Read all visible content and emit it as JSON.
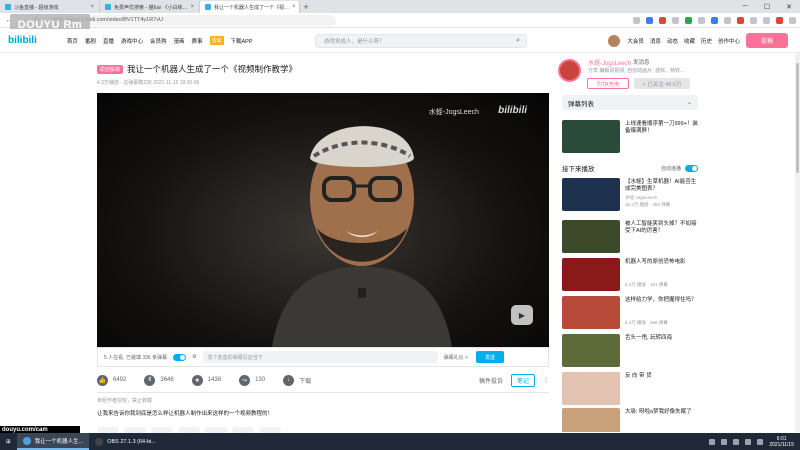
{
  "browser": {
    "tabs": [
      {
        "label": "斗鱼直播 - 超级游戏"
      },
      {
        "label": "免费声优搜索 - 猫Ear 《小白练…"
      },
      {
        "label": "我让一个机器人生成了一个《视…"
      }
    ],
    "url": "https://www.bilibili.com/video/BV1TT4y1R7vU"
  },
  "watermark": "DOUYU Rm",
  "site": {
    "logo": "bilibili",
    "nav": [
      "首页",
      "番剧",
      "直播",
      "游戏中心",
      "会员购",
      "漫画",
      "赛事"
    ],
    "nav_badge": "活动",
    "download_app": "下载APP",
    "search_placeholder": "游戏党成人，是什么呀？",
    "user_links": [
      "大会员",
      "消息",
      "动态",
      "收藏",
      "历史",
      "创作中心"
    ],
    "upload_button": "投稿"
  },
  "video": {
    "tag": "原创投稿",
    "title": "我让一个机器人生成了一个《视频制作教学》",
    "meta": "4.3万播放 · 总弹幕数236   2021-11-15 18:30:08",
    "channel_watermark": "水蛭-JogsLeech",
    "player_logo": "bilibili"
  },
  "danmu": {
    "viewers": "5 人在看, 已装填 336 条弹幕",
    "placeholder": "发个友善的弹幕见证当下",
    "etiquette": "弹幕礼仪 >",
    "send": "发送"
  },
  "actions": {
    "like": "6492",
    "coin": "3646",
    "fav": "1438",
    "share": "130",
    "download": "下载",
    "report": "稿件投诉",
    "note": "笔记"
  },
  "warning": "未经作者授权，禁止转载",
  "description": "让我来告诉你我到底是怎么样让机器人制作出来这样的一个视频教程的！",
  "uploader": {
    "name": "水蛭-JogsLeech",
    "message": "发消息",
    "desc": "分享 编解说视频, 自创动画片; 游戏、特效...",
    "charge": "为TA充电",
    "follow": "+ 已关注 46.6万"
  },
  "danmu_list": "弹幕列表",
  "next_play": "接下来播放",
  "autoplay": "自动连播",
  "recommendations": [
    {
      "title": "上线速看顺序第一刀999+！装备爆满屏！",
      "up": "",
      "stat": "",
      "color": "#2b4b3a"
    },
    {
      "title": "【水蛭】生草机器！AI能否生成完美图表？",
      "up": "水蛭-JogsLeech",
      "stat": "16.3万 播放 · 383 弹幕",
      "color": "#1e3250"
    },
    {
      "title": "被人工智能笑到头掉？不如接受下AI的厉害！",
      "up": "",
      "stat": "",
      "color": "#3d4a2a"
    },
    {
      "title": "机器人写的原创恐怖电影",
      "up": "",
      "stat": "5.4万 播放 · 181 弹幕",
      "color": "#8a1a1a"
    },
    {
      "title": "这样给力学，你把握得住吗？",
      "up": "",
      "stat": "6.4万 播放 · 460 弹幕",
      "color": "#b84a3a"
    },
    {
      "title": "舌头一甩, 玩转四海",
      "up": "",
      "stat": "",
      "color": "#5d6a3a"
    },
    {
      "title": "反 向 带 货",
      "up": "",
      "stat": "",
      "color": "#e2c2b0"
    },
    {
      "title": "大吸: 呀啦a梦我好像失眠了",
      "up": "",
      "stat": "",
      "color": "#c8a07a"
    }
  ],
  "taskbar": {
    "items": [
      "我让一个机器人生...",
      "OBS 27.1.3 (64-bi..."
    ],
    "time": "6:01",
    "date": "2021/11/15"
  },
  "douyu_tag": "douyu.com/cam"
}
